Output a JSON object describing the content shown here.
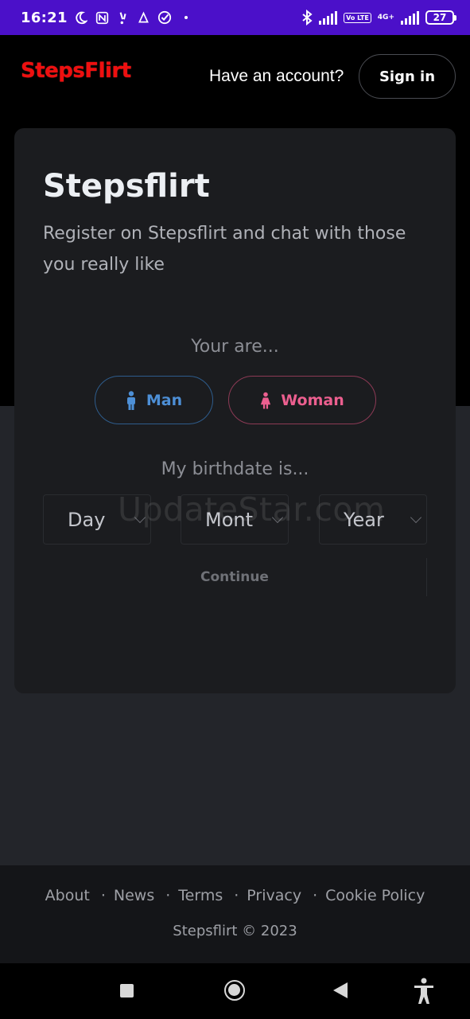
{
  "status_bar": {
    "time": "16:21",
    "battery": "27",
    "network_label": "4G+",
    "volte_label": "Vo LTE",
    "left_icons": [
      "moon-icon",
      "nfc-icon",
      "signal-alert-icon",
      "notification-icon",
      "check-icon",
      "dot-icon"
    ],
    "right_icons": [
      "bluetooth-icon",
      "signal-icon",
      "signal-icon"
    ]
  },
  "header": {
    "logo": "StepsFlirt",
    "have_account": "Have an account?",
    "sign_in": "Sign in"
  },
  "card": {
    "title": "Stepsflirt",
    "subtitle": "Register on Stepsflirt and chat with those you really like",
    "you_are_label": "Your are...",
    "man_label": "Man",
    "woman_label": "Woman",
    "birthdate_label": "My birthdate is...",
    "day_placeholder": "Day",
    "month_placeholder": "Mont",
    "year_placeholder": "Year",
    "continue_label": "Continue"
  },
  "watermark": "UpdateStar.com",
  "footer": {
    "links": [
      "About",
      "News",
      "Terms",
      "Privacy",
      "Cookie Policy"
    ],
    "copyright": "Stepsflirt © 2023"
  },
  "colors": {
    "status_bar": "#4b10c9",
    "logo": "#ee0f0f",
    "man": "#4d8fd6",
    "woman": "#ec5f8f"
  }
}
